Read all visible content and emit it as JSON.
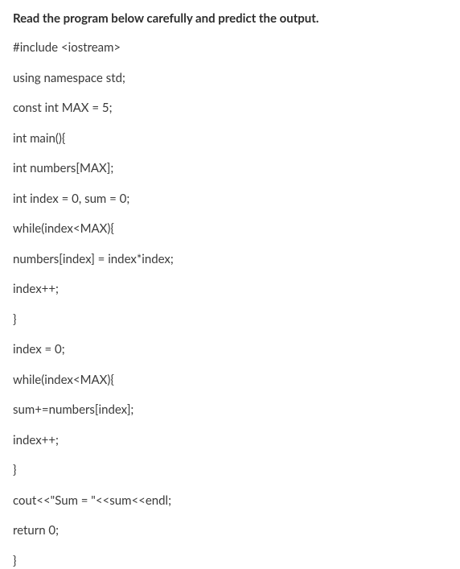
{
  "question": {
    "title": "Read the program below carefully and predict the output."
  },
  "code": {
    "line1": "#include <iostream>",
    "line2": "using namespace std;",
    "line3": "const int MAX = 5;",
    "line4": "int main(){",
    "line5": "int numbers[MAX];",
    "line6": "int index = 0, sum = 0;",
    "line7": "while(index<MAX){",
    "line8": "numbers[index] = index*index;",
    "line9": "index++;",
    "line10": "}",
    "line11": "index = 0;",
    "line12": "while(index<MAX){",
    "line13": "sum+=numbers[index];",
    "line14": "index++;",
    "line15": "}",
    "line16": "cout<<\"Sum = \"<<sum<<endl;",
    "line17": "return 0;",
    "line18": "}"
  }
}
